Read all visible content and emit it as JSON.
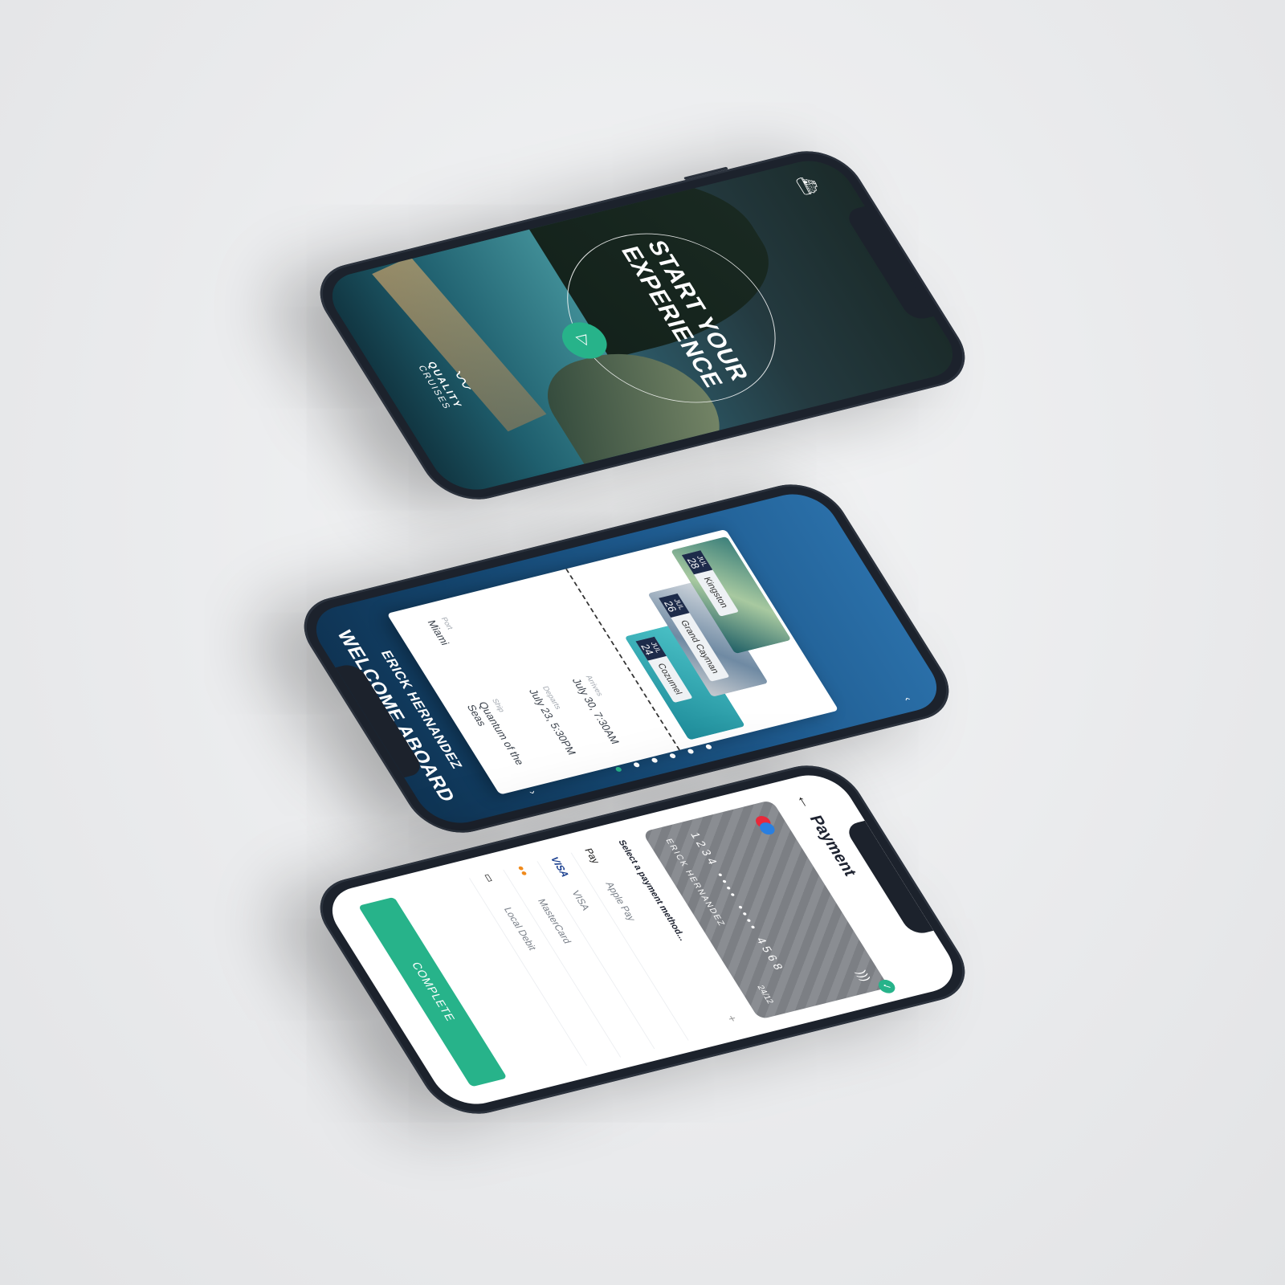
{
  "splash": {
    "title": "START YOUR EXPERIENCE",
    "play_icon": "play-icon",
    "brand_top": "QUALITY",
    "brand_bottom": "CRUISES",
    "ship_icon": "ship-icon"
  },
  "welcome": {
    "title": "WELCOME ABOARD",
    "name": "ERICK HERNANDEZ",
    "ship_label": "Ship",
    "ship_value": "Quantum of the Seas",
    "port_label": "Port",
    "port_value": "Miami",
    "departs_label": "Departs",
    "departs_value": "July 23, 5:30PM",
    "arrives_label": "Arrives",
    "arrives_value": "July 30, 7:30AM",
    "stops": [
      {
        "month": "JUL",
        "day": "24",
        "name": "Cozumel"
      },
      {
        "month": "JUL",
        "day": "26",
        "name": "Grand Cayman"
      },
      {
        "month": "JUL",
        "day": "28",
        "name": "Kingston"
      }
    ],
    "page_count": 6,
    "active_page": 1
  },
  "payment": {
    "title": "Payment",
    "card_number": "1234 •••• •••• 4568",
    "card_name": "ERICK HERNANDEZ",
    "card_exp": "24/12",
    "select_label": "Select a payment method...",
    "methods": [
      {
        "icon": " Pay",
        "name": "Apple Pay"
      },
      {
        "icon": "VISA",
        "name": "VISA"
      },
      {
        "icon": "●●",
        "name": "MasterCard"
      },
      {
        "icon": "▭",
        "name": "Local Debit"
      }
    ],
    "complete_label": "COMPLETE"
  },
  "colors": {
    "accent": "#27b38a",
    "frame": "#1c222c",
    "navy": "#1d2b4a"
  }
}
